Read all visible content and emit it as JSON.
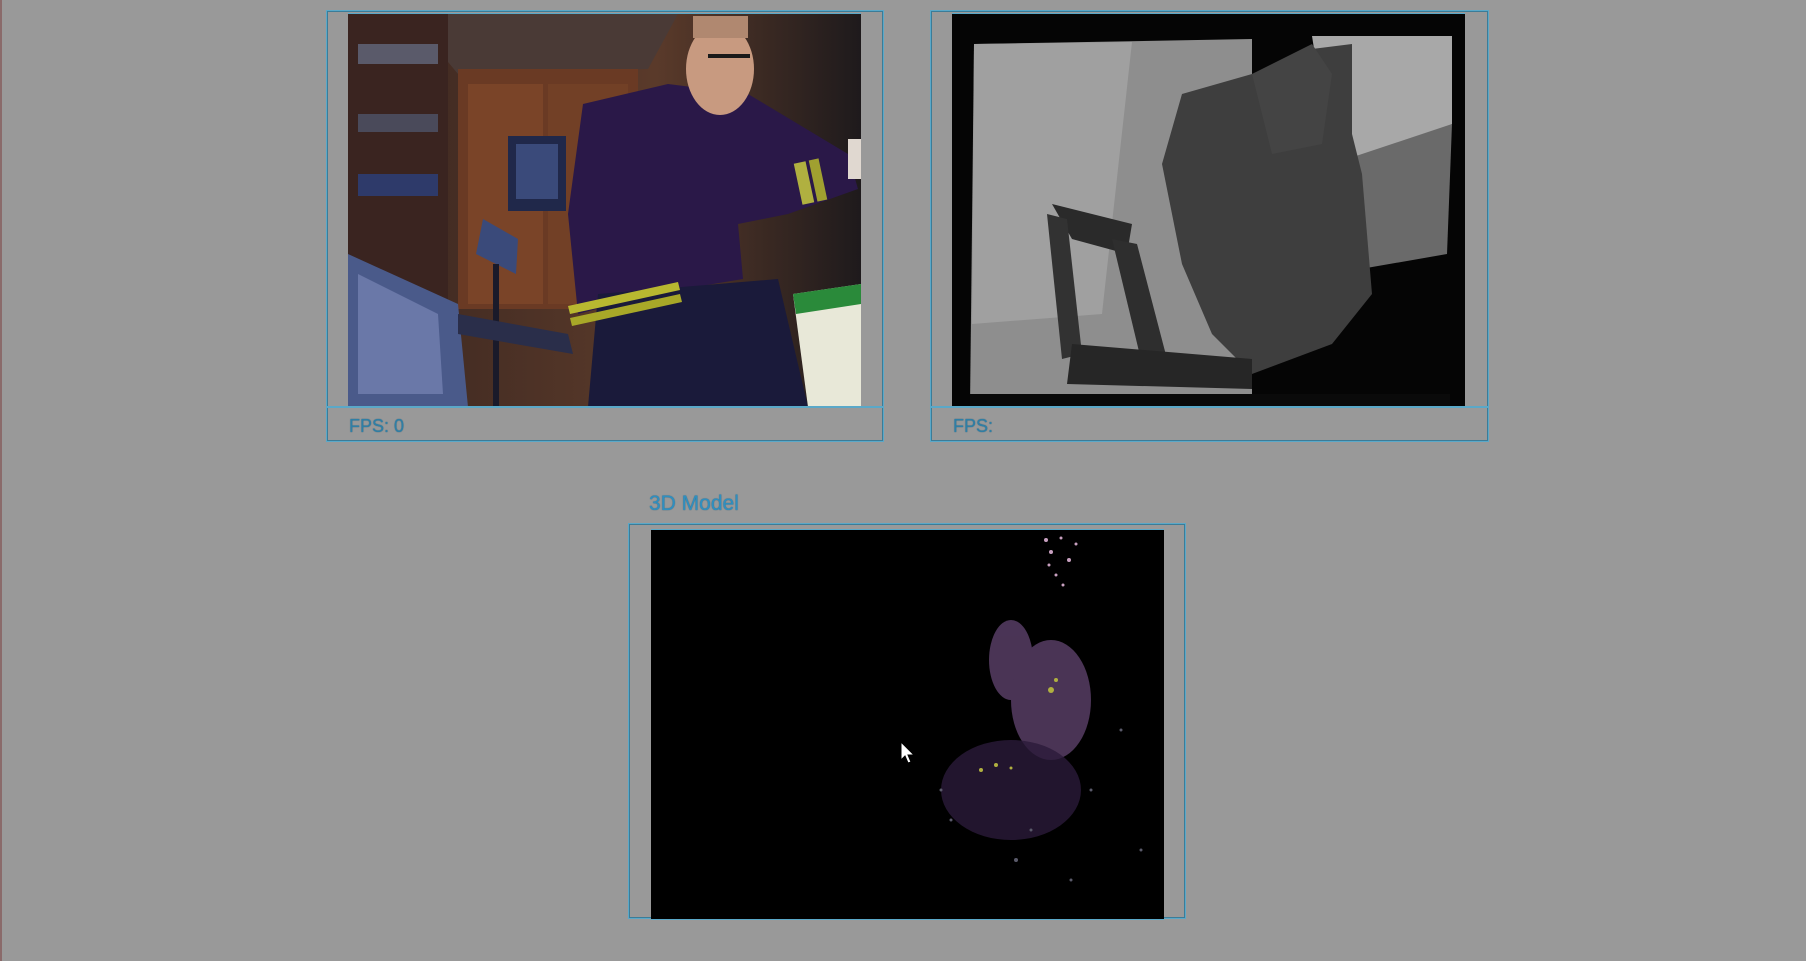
{
  "panels": {
    "rgb": {
      "fps_label": "FPS: 0"
    },
    "depth": {
      "fps_label": "FPS:"
    },
    "model": {
      "title": "3D Model"
    }
  },
  "icons": {
    "cursor": "mouse-pointer-icon"
  }
}
